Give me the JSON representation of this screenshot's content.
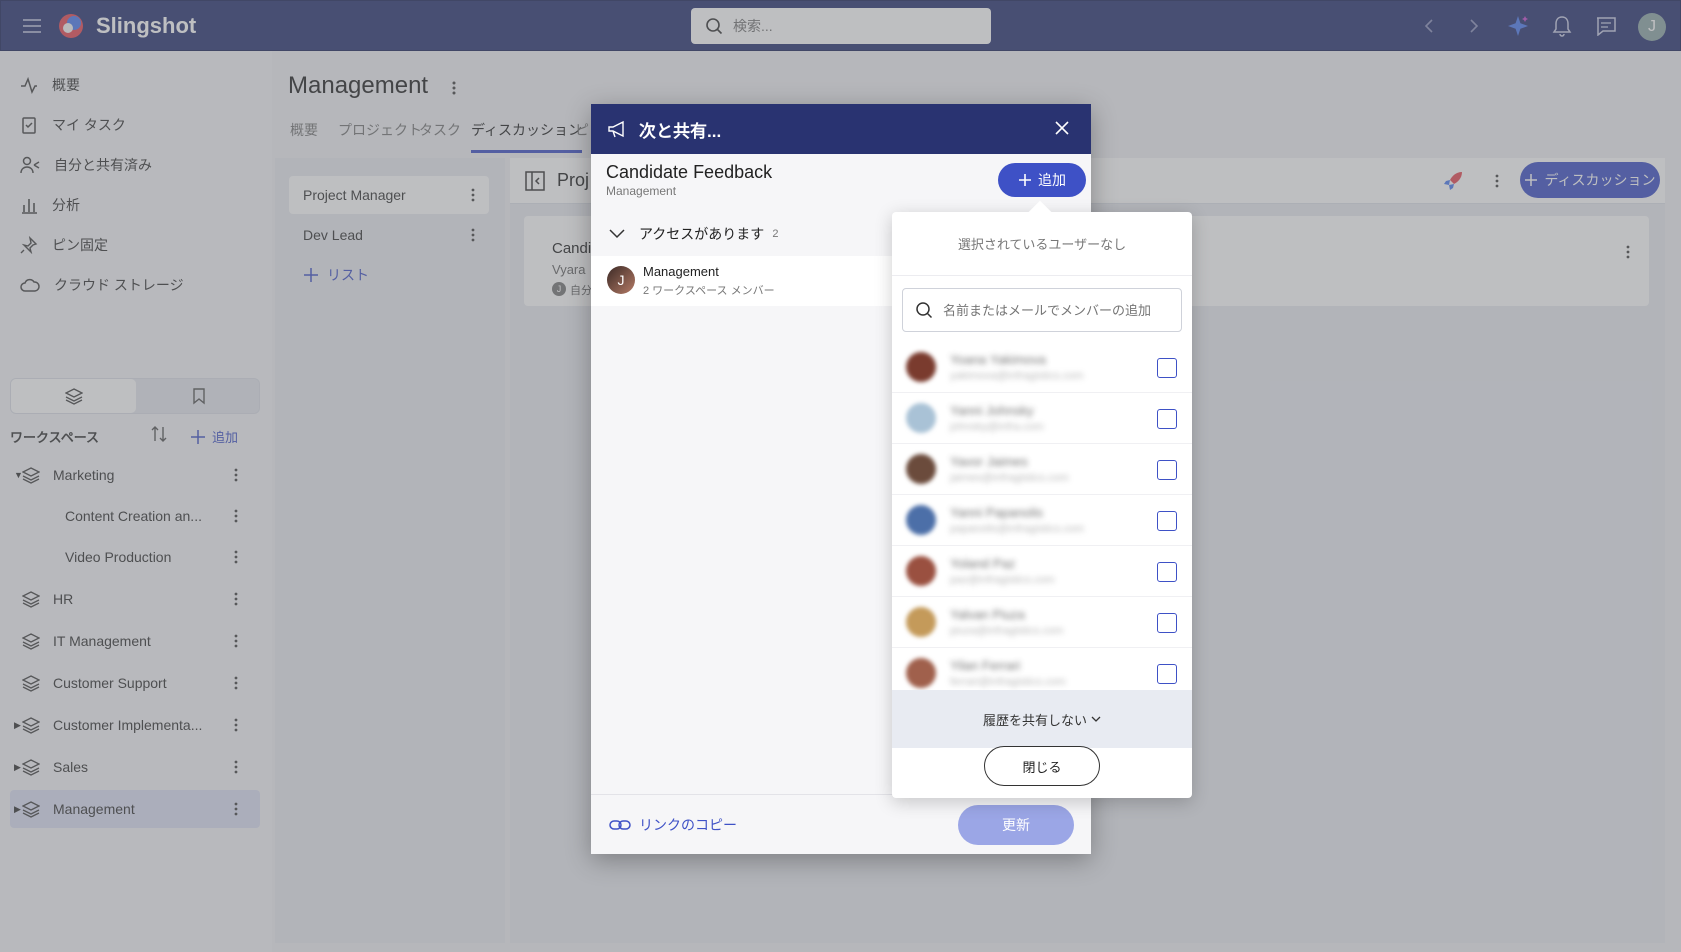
{
  "app": {
    "name": "Slingshot"
  },
  "topbar": {
    "search_placeholder": "検索...",
    "avatar_initial": "J"
  },
  "sidebar": {
    "nav": [
      {
        "label": "概要"
      },
      {
        "label": "マイ タスク"
      },
      {
        "label": "自分と共有済み"
      },
      {
        "label": "分析"
      },
      {
        "label": "ピン固定"
      },
      {
        "label": "クラウド ストレージ"
      }
    ],
    "workspaces_title": "ワークスペース",
    "add_label": "追加",
    "workspaces": [
      {
        "label": "Marketing"
      },
      {
        "label": "Content Creation an..."
      },
      {
        "label": "Video Production"
      },
      {
        "label": "HR"
      },
      {
        "label": "IT Management"
      },
      {
        "label": "Customer Support"
      },
      {
        "label": "Customer Implementa..."
      },
      {
        "label": "Sales"
      },
      {
        "label": "Management"
      }
    ]
  },
  "main": {
    "title": "Management",
    "tabs": [
      {
        "label": "概要"
      },
      {
        "label": "プロジェクト"
      },
      {
        "label": "タスク"
      },
      {
        "label": "ディスカッション"
      },
      {
        "label": "ピ"
      }
    ],
    "lists": [
      {
        "label": "Project Manager"
      },
      {
        "label": "Dev Lead"
      }
    ],
    "add_list_label": "リスト",
    "board_title": "Proj",
    "add_discussion_label": "ディスカッション",
    "card": {
      "title": "Candi",
      "author": "Vyara",
      "meta": "自分",
      "avatar": "J"
    }
  },
  "modal": {
    "title": "次と共有...",
    "item_title": "Candidate Feedback",
    "item_subtitle": "Management",
    "add_label": "追加",
    "access_label": "アクセスがあります",
    "access_count": "2",
    "member": {
      "name": "Management",
      "detail": "2 ワークスペース メンバー",
      "avatar": "J"
    },
    "copy_link_label": "リンクのコピー",
    "update_label": "更新"
  },
  "dropdown": {
    "no_users_text": "選択されているユーザーなし",
    "search_placeholder": "名前またはメールでメンバーの追加",
    "users": [
      {
        "name": "Yoana Yakimova",
        "email": "yakimova@infragistics.com"
      },
      {
        "name": "Yanni Johnsky",
        "email": "johnsky@infra.com"
      },
      {
        "name": "Yavor Jaimes",
        "email": "jaimes@infragistics.com"
      },
      {
        "name": "Yanni Papanolis",
        "email": "papanolis@infragistics.com"
      },
      {
        "name": "Yoland Paz",
        "email": "paz@infragistics.com"
      },
      {
        "name": "Yalvan Piuza",
        "email": "piuza@infragistics.com"
      },
      {
        "name": "Yilan Ferrari",
        "email": "ferrari@infragistics.com"
      }
    ],
    "history_label": "履歴を共有しない",
    "close_label": "閉じる"
  },
  "colors": {
    "topbar": "#293371",
    "accent": "#3e51c6",
    "selected": "#dde1f5"
  }
}
